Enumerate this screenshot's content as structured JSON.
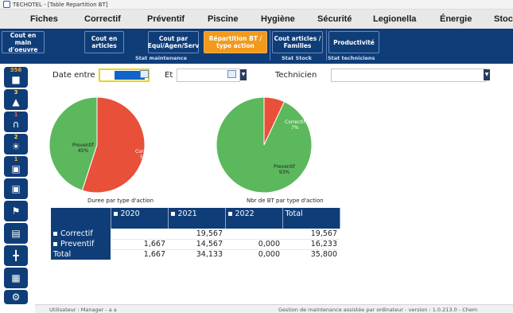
{
  "window": {
    "title": "TECHOTEL - [Table Repartition BT]"
  },
  "menu": [
    "Fiches",
    "Correctif",
    "Préventif",
    "Piscine",
    "Hygiène",
    "Sécurité",
    "Legionella",
    "Énergie",
    "Stoc"
  ],
  "ribbon": {
    "buttons": [
      {
        "label": "Cout en main d'oeuvre",
        "active": false
      },
      {
        "label": "Cout en articles",
        "active": false
      },
      {
        "label": "Cout par Equi/Agen/Serv",
        "active": false
      },
      {
        "label": "Répartition BT / type action",
        "active": true
      },
      {
        "label": "Cout articles / Familles",
        "active": false
      },
      {
        "label": "Productivité",
        "active": false
      }
    ],
    "groups": [
      "Stat maintenance",
      "Stat Stock",
      "Stat techniciens"
    ]
  },
  "sidebar": {
    "badges": [
      "356",
      "3",
      "1",
      "2",
      "1"
    ]
  },
  "filters": {
    "date_label": "Date entre",
    "date_from": "",
    "and_label": "Et",
    "date_to": "",
    "technician_label": "Technicien",
    "technician_value": ""
  },
  "chart_data": [
    {
      "type": "pie",
      "title": "Duree par type d'action",
      "labels": [
        "Preventif",
        "Correctif"
      ],
      "values": [
        45,
        55
      ],
      "display": [
        "45%",
        "55%"
      ],
      "colors": [
        "#5cb85c",
        "#e8503a"
      ]
    },
    {
      "type": "pie",
      "title": "Nbr de BT par type d'action",
      "labels": [
        "Correctif",
        "Preventif"
      ],
      "values": [
        7,
        93
      ],
      "display": [
        "7%",
        "93%"
      ],
      "colors": [
        "#e8503a",
        "#5cb85c"
      ]
    }
  ],
  "table": {
    "columns": [
      "2020",
      "2021",
      "2022",
      "Total"
    ],
    "rows": [
      {
        "label": "Correctif",
        "values": [
          "",
          "19,567",
          "",
          "19,567"
        ]
      },
      {
        "label": "Preventif",
        "values": [
          "1,667",
          "14,567",
          "0,000",
          "16,233"
        ]
      },
      {
        "label": "Total",
        "values": [
          "1,667",
          "34,133",
          "0,000",
          "35,800"
        ]
      }
    ]
  },
  "status": {
    "user": "Utilisateur : Manager - a a",
    "app": "Gestion de maintenance assistée par ordinateur - version : 1.0.213.0 - Chem"
  },
  "colors": {
    "navy": "#0f3d78",
    "accent": "#f39a1c",
    "correctif": "#e8503a",
    "preventif": "#5cb85c"
  }
}
